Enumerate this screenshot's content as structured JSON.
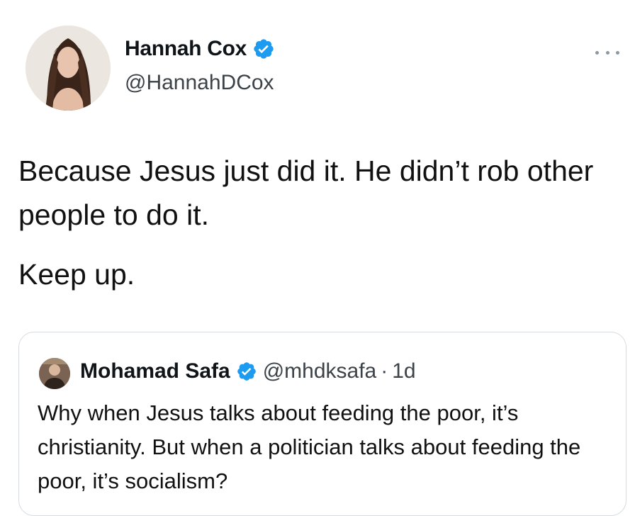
{
  "tweet": {
    "author": {
      "name": "Hannah Cox",
      "handle": "@HannahDCox",
      "verified": true
    },
    "text_paragraphs": [
      "Because Jesus just did it. He didn’t rob other people to do it.",
      "Keep up."
    ],
    "quoted_tweet": {
      "author": {
        "name": "Mohamad Safa",
        "handle": "@mhdksafa",
        "verified": true
      },
      "separator": "·",
      "time": "1d",
      "text": "Why when Jesus talks about feeding the poor, it’s christianity. But when a politician talks about feeding the poor, it’s socialism?"
    }
  },
  "icons": {
    "verified": "verified-badge-icon",
    "more": "more-options-icon"
  },
  "colors": {
    "verified_blue": "#1d9bf0",
    "text": "#0f1419",
    "secondary_text": "#3b4248",
    "border": "#d5dbe0"
  }
}
